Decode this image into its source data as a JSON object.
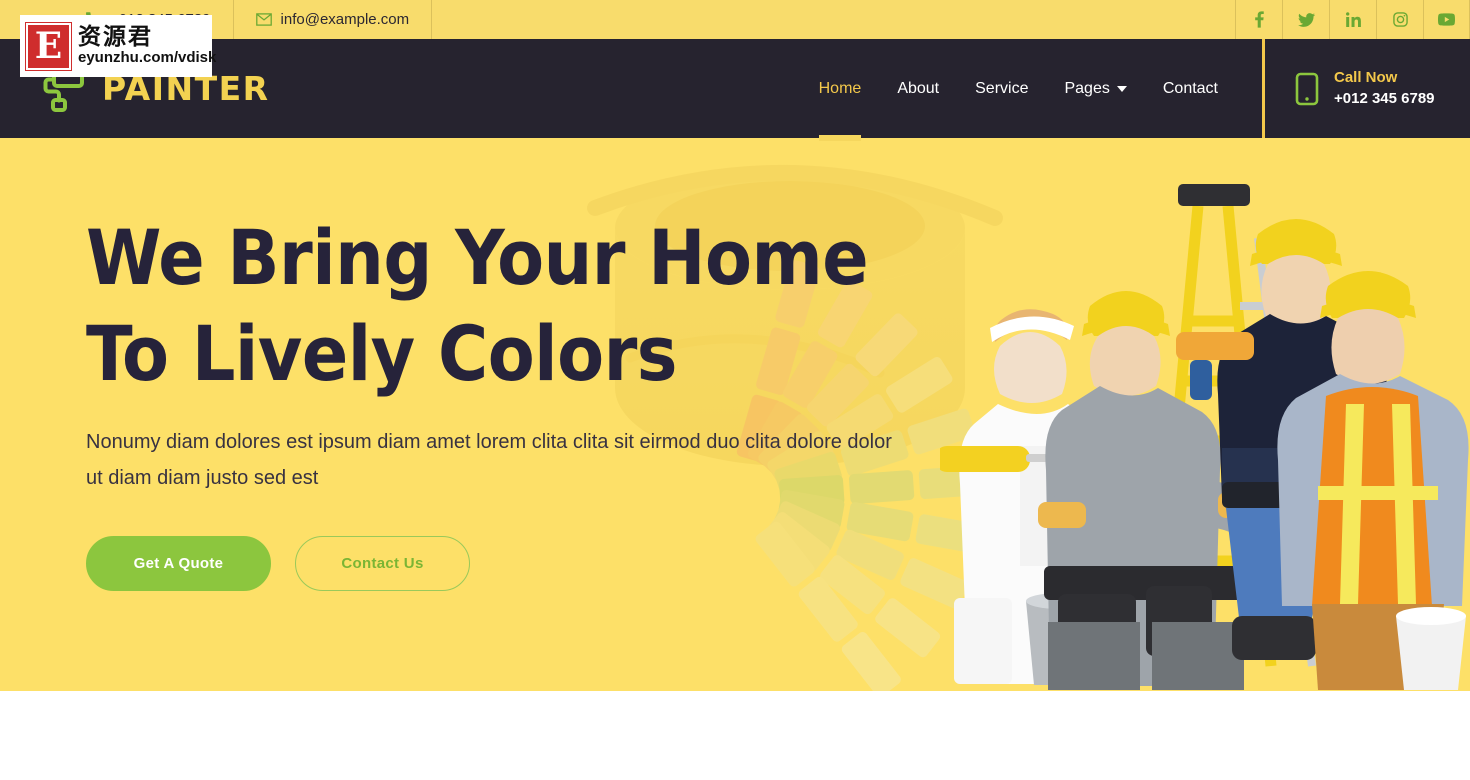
{
  "topbar": {
    "phone": "+012 345 6789",
    "email": "info@example.com",
    "phone_icon": "phone-icon",
    "email_icon": "envelope-icon",
    "social": [
      {
        "name": "facebook-icon",
        "label": "Facebook"
      },
      {
        "name": "twitter-icon",
        "label": "Twitter"
      },
      {
        "name": "linkedin-icon",
        "label": "LinkedIn"
      },
      {
        "name": "instagram-icon",
        "label": "Instagram"
      },
      {
        "name": "youtube-icon",
        "label": "YouTube"
      }
    ]
  },
  "navbar": {
    "brand": "PAINTER",
    "brand_icon": "paint-roller-icon",
    "menu": [
      {
        "label": "Home",
        "active": true,
        "dropdown": false
      },
      {
        "label": "About",
        "active": false,
        "dropdown": false
      },
      {
        "label": "Service",
        "active": false,
        "dropdown": false
      },
      {
        "label": "Pages",
        "active": false,
        "dropdown": true
      },
      {
        "label": "Contact",
        "active": false,
        "dropdown": false
      }
    ],
    "call": {
      "icon": "mobile-phone-icon",
      "label": "Call Now",
      "number": "+012 345 6789"
    }
  },
  "hero": {
    "title": "We Bring Your Home To Lively Colors",
    "subtitle": "Nonumy diam dolores est ipsum diam amet lorem clita clita sit eirmod duo clita dolore dolor ut diam diam justo sed est",
    "primary_button": "Get A Quote",
    "outline_button": "Contact Us",
    "photo_alt": "four painters and construction workers with ladder"
  },
  "watermark": {
    "badge": "E",
    "chinese": "资源君",
    "url": "eyunzhu.com/vdisk"
  },
  "colors": {
    "topbar_yellow": "#f8dc6c",
    "hero_yellow": "#fde068",
    "navbar_dark": "#26232f",
    "brand_gold": "#f3d251",
    "accent_green": "#8cc63e",
    "heading_navy": "#26233a",
    "nav_active": "#f3c84b"
  }
}
